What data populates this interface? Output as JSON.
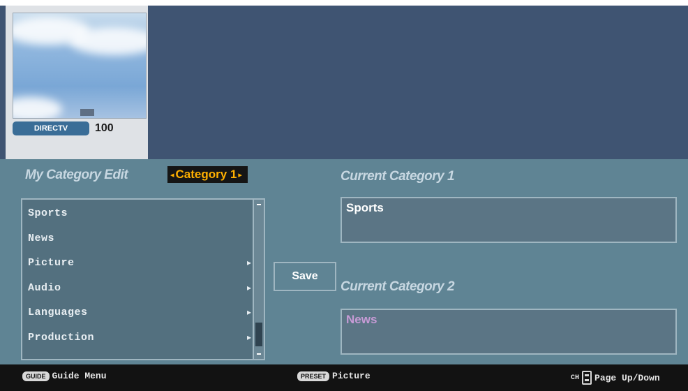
{
  "preview": {
    "network_label": "DIRECTV",
    "channel_number": "100"
  },
  "menu": {
    "title": "My Category Edit",
    "selector": {
      "left_arrow": "◂",
      "label": "Category 1",
      "right_arrow": "▸"
    }
  },
  "category_list": [
    {
      "label": "Sports",
      "has_submenu": false
    },
    {
      "label": "News",
      "has_submenu": false
    },
    {
      "label": "Picture",
      "has_submenu": true
    },
    {
      "label": "Audio",
      "has_submenu": true
    },
    {
      "label": "Languages",
      "has_submenu": true
    },
    {
      "label": "Production",
      "has_submenu": true
    }
  ],
  "submenu_glyph": "▸",
  "save_label": "Save",
  "current": [
    {
      "title": "Current Category 1",
      "value": "Sports",
      "value_color": "#ffffff"
    },
    {
      "title": "Current Category 2",
      "value": "News",
      "value_color": "#c79bd6"
    }
  ],
  "footer": {
    "guide": {
      "chip": "GUIDE",
      "label": "Guide Menu"
    },
    "picture": {
      "chip": "PRESET",
      "label": "Picture"
    },
    "page": {
      "chip": "CH",
      "label": "Page Up/Down"
    }
  },
  "colors": {
    "header_bg": "#3f5472",
    "panel_bg": "#5f8494",
    "selector_bg": "#151515",
    "selector_text": "#ffb000",
    "footer_bg": "#121212"
  }
}
